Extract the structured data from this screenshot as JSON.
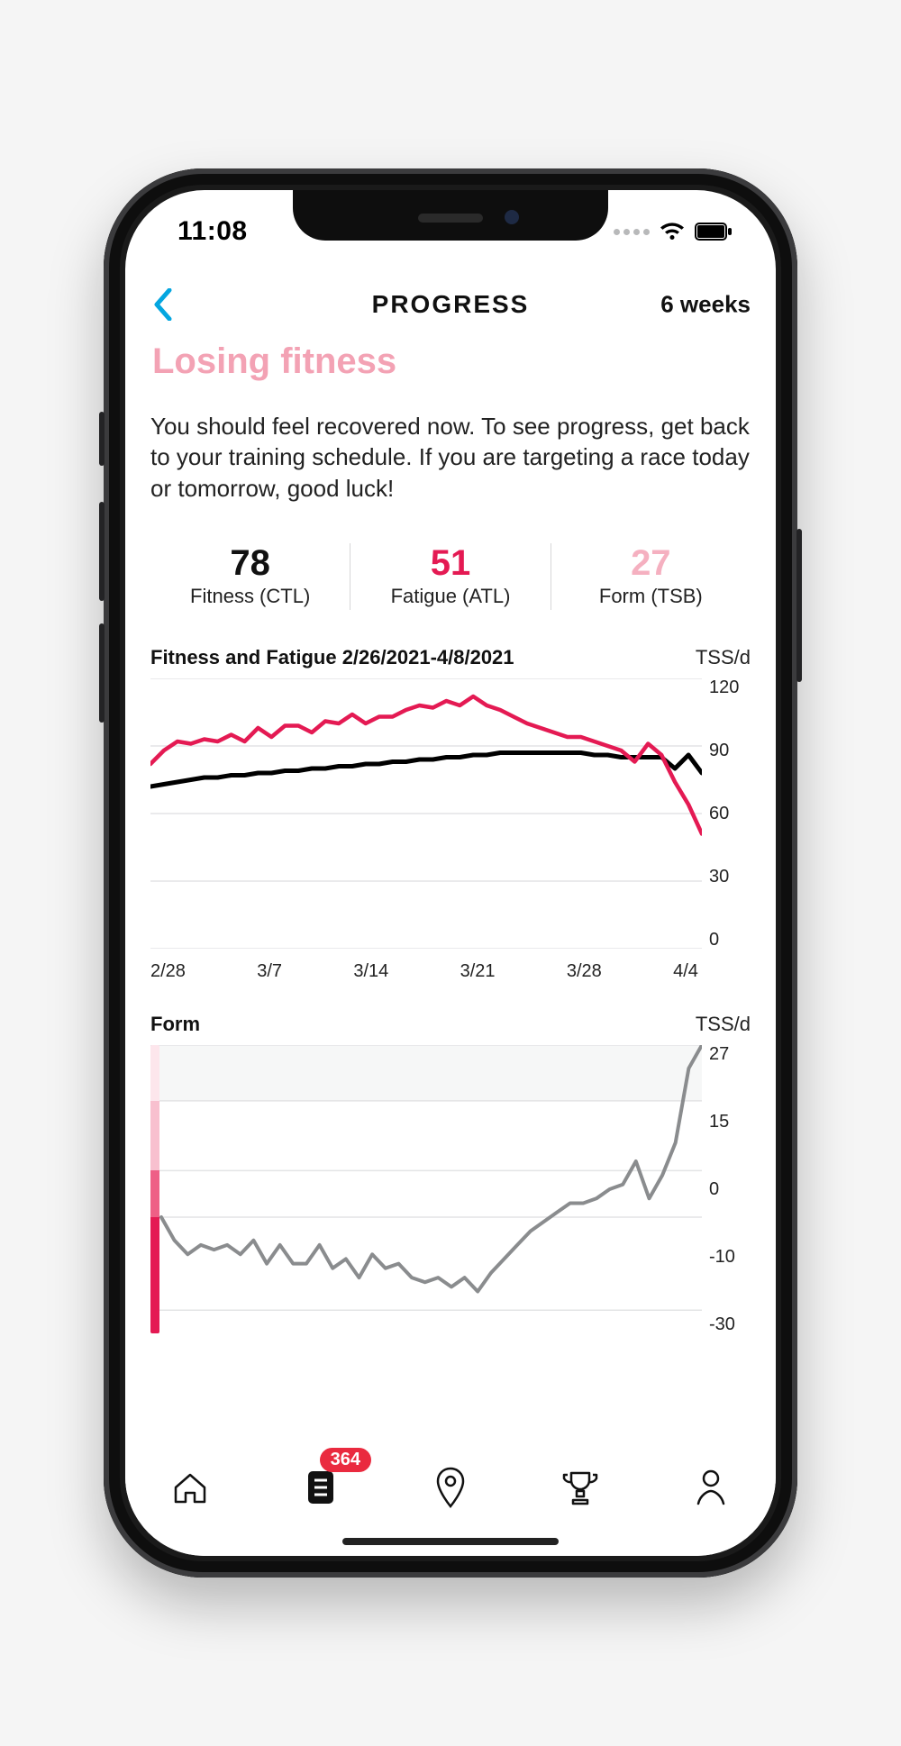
{
  "status_bar": {
    "time": "11:08"
  },
  "header": {
    "title": "PROGRESS",
    "range": "6 weeks"
  },
  "summary": {
    "heading": "Losing fitness",
    "description": "You should feel recovered now. To see progress, get back to your training schedule. If you are targeting a race today or tomorrow, good luck!"
  },
  "metrics": {
    "fitness": {
      "value": "78",
      "label": "Fitness (CTL)"
    },
    "fatigue": {
      "value": "51",
      "label": "Fatigue (ATL)"
    },
    "form": {
      "value": "27",
      "label": "Form (TSB)"
    }
  },
  "chart1": {
    "title": "Fitness and Fatigue 2/26/2021-4/8/2021",
    "yunit": "TSS/d"
  },
  "chart2": {
    "title": "Form",
    "yunit": "TSS/d"
  },
  "tabbar": {
    "badge": "364"
  },
  "colors": {
    "pink": "#f3a2b4",
    "magenta": "#e41a53",
    "cyan": "#04a6e0",
    "grey_line": "#8a8c8e"
  },
  "chart_data": [
    {
      "type": "line",
      "title": "Fitness and Fatigue 2/26/2021-4/8/2021",
      "xlabel": "",
      "ylabel": "TSS/d",
      "categories": [
        "2/28",
        "3/7",
        "3/14",
        "3/21",
        "3/28",
        "4/4"
      ],
      "ylim": [
        0,
        120
      ],
      "yTicks": [
        "120",
        "90",
        "60",
        "30",
        "0"
      ],
      "series": [
        {
          "name": "Fitness (CTL)",
          "color": "#000000",
          "values": [
            72,
            73,
            74,
            75,
            76,
            76,
            77,
            77,
            78,
            78,
            79,
            79,
            80,
            80,
            81,
            81,
            82,
            82,
            83,
            83,
            84,
            84,
            85,
            85,
            86,
            86,
            87,
            87,
            87,
            87,
            87,
            87,
            87,
            86,
            86,
            85,
            85,
            85,
            85,
            80,
            86,
            78
          ]
        },
        {
          "name": "Fatigue (ATL)",
          "color": "#e41a53",
          "values": [
            82,
            88,
            92,
            91,
            93,
            92,
            95,
            92,
            98,
            94,
            99,
            99,
            96,
            101,
            100,
            104,
            100,
            103,
            103,
            106,
            108,
            107,
            110,
            108,
            112,
            108,
            106,
            103,
            100,
            98,
            96,
            94,
            94,
            92,
            90,
            88,
            83,
            91,
            86,
            74,
            64,
            51
          ]
        }
      ]
    },
    {
      "type": "line",
      "title": "Form",
      "xlabel": "",
      "ylabel": "TSS/d",
      "categories": [
        "2/28",
        "3/7",
        "3/14",
        "3/21",
        "3/28",
        "4/4"
      ],
      "ylim": [
        -35,
        27
      ],
      "yTicks": [
        "27",
        "15",
        "0",
        "-10",
        "-30"
      ],
      "series": [
        {
          "name": "Form (TSB)",
          "color": "#8a8c8e",
          "values": [
            -10,
            -15,
            -18,
            -16,
            -17,
            -16,
            -18,
            -15,
            -20,
            -16,
            -20,
            -20,
            -16,
            -21,
            -19,
            -23,
            -18,
            -21,
            -20,
            -23,
            -24,
            -23,
            -25,
            -23,
            -26,
            -22,
            -19,
            -16,
            -13,
            -11,
            -9,
            -7,
            -7,
            -6,
            -4,
            -3,
            2,
            -6,
            -1,
            6,
            22,
            27
          ]
        }
      ],
      "zones": [
        {
          "from": 27,
          "to": 15,
          "color": "#fde6ec"
        },
        {
          "from": 15,
          "to": 0,
          "color": "#f8c0cf"
        },
        {
          "from": 0,
          "to": -10,
          "color": "#ee5f86"
        },
        {
          "from": -10,
          "to": -35,
          "color": "#e41a53"
        }
      ]
    }
  ]
}
